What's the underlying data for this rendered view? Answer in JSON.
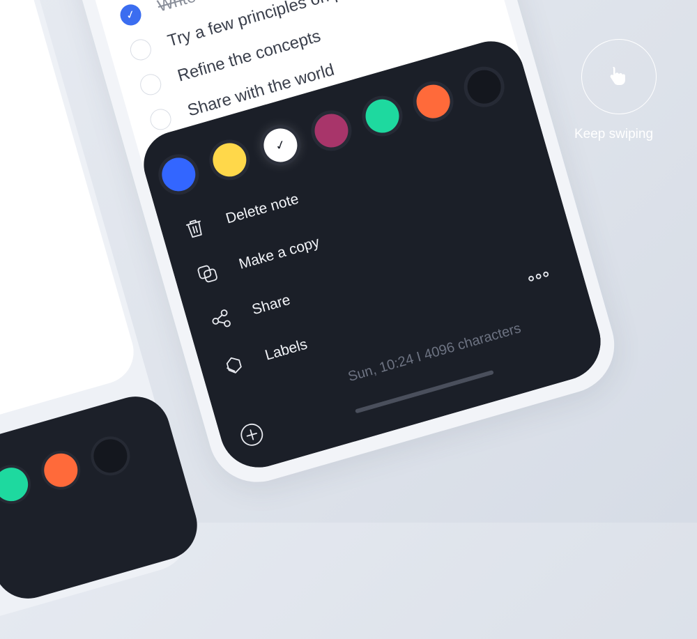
{
  "todos": [
    {
      "text": "Write",
      "done": true
    },
    {
      "text": "Try a few principles on practice",
      "done": false
    },
    {
      "text": "Refine the concepts",
      "done": false
    },
    {
      "text": "Share with the world",
      "done": false
    }
  ],
  "palette": {
    "colors": [
      "#3366ff",
      "#ffd84a",
      "#ffffff",
      "#a8356a",
      "#1ed99f",
      "#ff6a3a",
      "#14171e"
    ],
    "selected_index": 2,
    "check_glyph": "✓"
  },
  "menu": {
    "delete_label": "Delete note",
    "copy_label": "Make a copy",
    "share_label": "Share",
    "labels_label": "Labels"
  },
  "note_meta": "Sun, 10:24  I  4096 characters",
  "icons": {
    "delete": "trash-icon",
    "copy": "copy-icon",
    "share": "share-icon",
    "labels": "label-icon",
    "more": "more-icon",
    "add": "add-icon",
    "swipe": "hand-swipe-icon"
  },
  "swipe_hint": "Keep swiping",
  "left_sheet_colors": [
    "#1ed99f",
    "#ff6a3a",
    "#14171e"
  ]
}
